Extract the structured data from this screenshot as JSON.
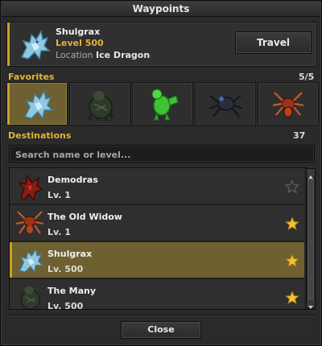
{
  "window": {
    "title": "Waypoints"
  },
  "selected": {
    "name": "Shulgrax",
    "level_label": "Level 500",
    "location_label": "Location",
    "location_value": "Ice Dragon",
    "portrait_icon": "ice-dragon-icon",
    "travel_label": "Travel"
  },
  "favorites": {
    "label": "Favorites",
    "count": "5/5",
    "items": [
      {
        "icon": "ice-dragon-icon",
        "active": true
      },
      {
        "icon": "dark-bear-icon",
        "active": false
      },
      {
        "icon": "green-golem-icon",
        "active": false
      },
      {
        "icon": "dark-spider-icon",
        "active": false
      },
      {
        "icon": "red-spider-icon",
        "active": false
      }
    ]
  },
  "destinations": {
    "label": "Destinations",
    "count": "37",
    "search_placeholder": "Search name or level...",
    "items": [
      {
        "name": "Demodras",
        "level": "Lv. 1",
        "icon": "red-dragon-icon",
        "favorite": false,
        "selected": false
      },
      {
        "name": "The Old Widow",
        "level": "Lv. 1",
        "icon": "red-spider-icon",
        "favorite": true,
        "selected": false
      },
      {
        "name": "Shulgrax",
        "level": "Lv. 500",
        "icon": "ice-dragon-icon",
        "favorite": true,
        "selected": true
      },
      {
        "name": "The Many",
        "level": "Lv. 500",
        "icon": "dark-bear-icon",
        "favorite": true,
        "selected": false
      }
    ]
  },
  "footer": {
    "close_label": "Close"
  },
  "colors": {
    "accent": "#c9a227",
    "selected_row": "#6e6030",
    "level_text": "#e0b43a",
    "star_on": "#f2c232",
    "star_off": "#5a5a5a"
  }
}
